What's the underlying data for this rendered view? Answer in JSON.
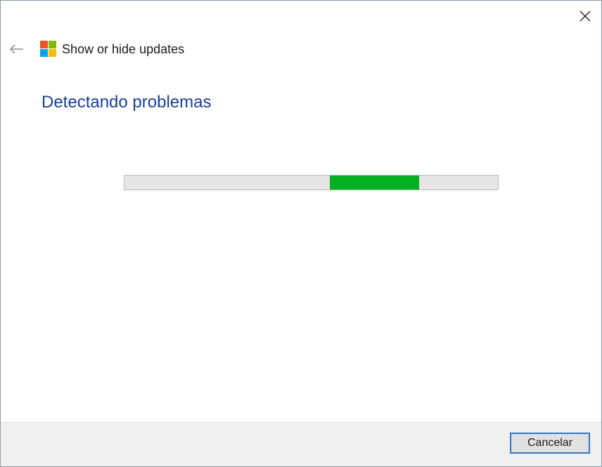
{
  "window": {
    "close_icon": "close-icon",
    "back_icon": "back-arrow-icon"
  },
  "header": {
    "title": "Show or hide updates",
    "logo_icon": "windows-logo-icon",
    "logo_colors": [
      "#f25022",
      "#7fba00",
      "#00a4ef",
      "#ffb900"
    ]
  },
  "main": {
    "heading": "Detectando problemas",
    "progress": {
      "style": "indeterminate-marquee",
      "segment_start_fraction": 0.55,
      "segment_width_fraction": 0.24,
      "fill_color": "#06b025",
      "track_color": "#e6e6e6"
    }
  },
  "footer": {
    "cancel_label": "Cancelar"
  },
  "colors": {
    "heading": "#1b3f94",
    "button_focus_border": "#2f78c8"
  }
}
